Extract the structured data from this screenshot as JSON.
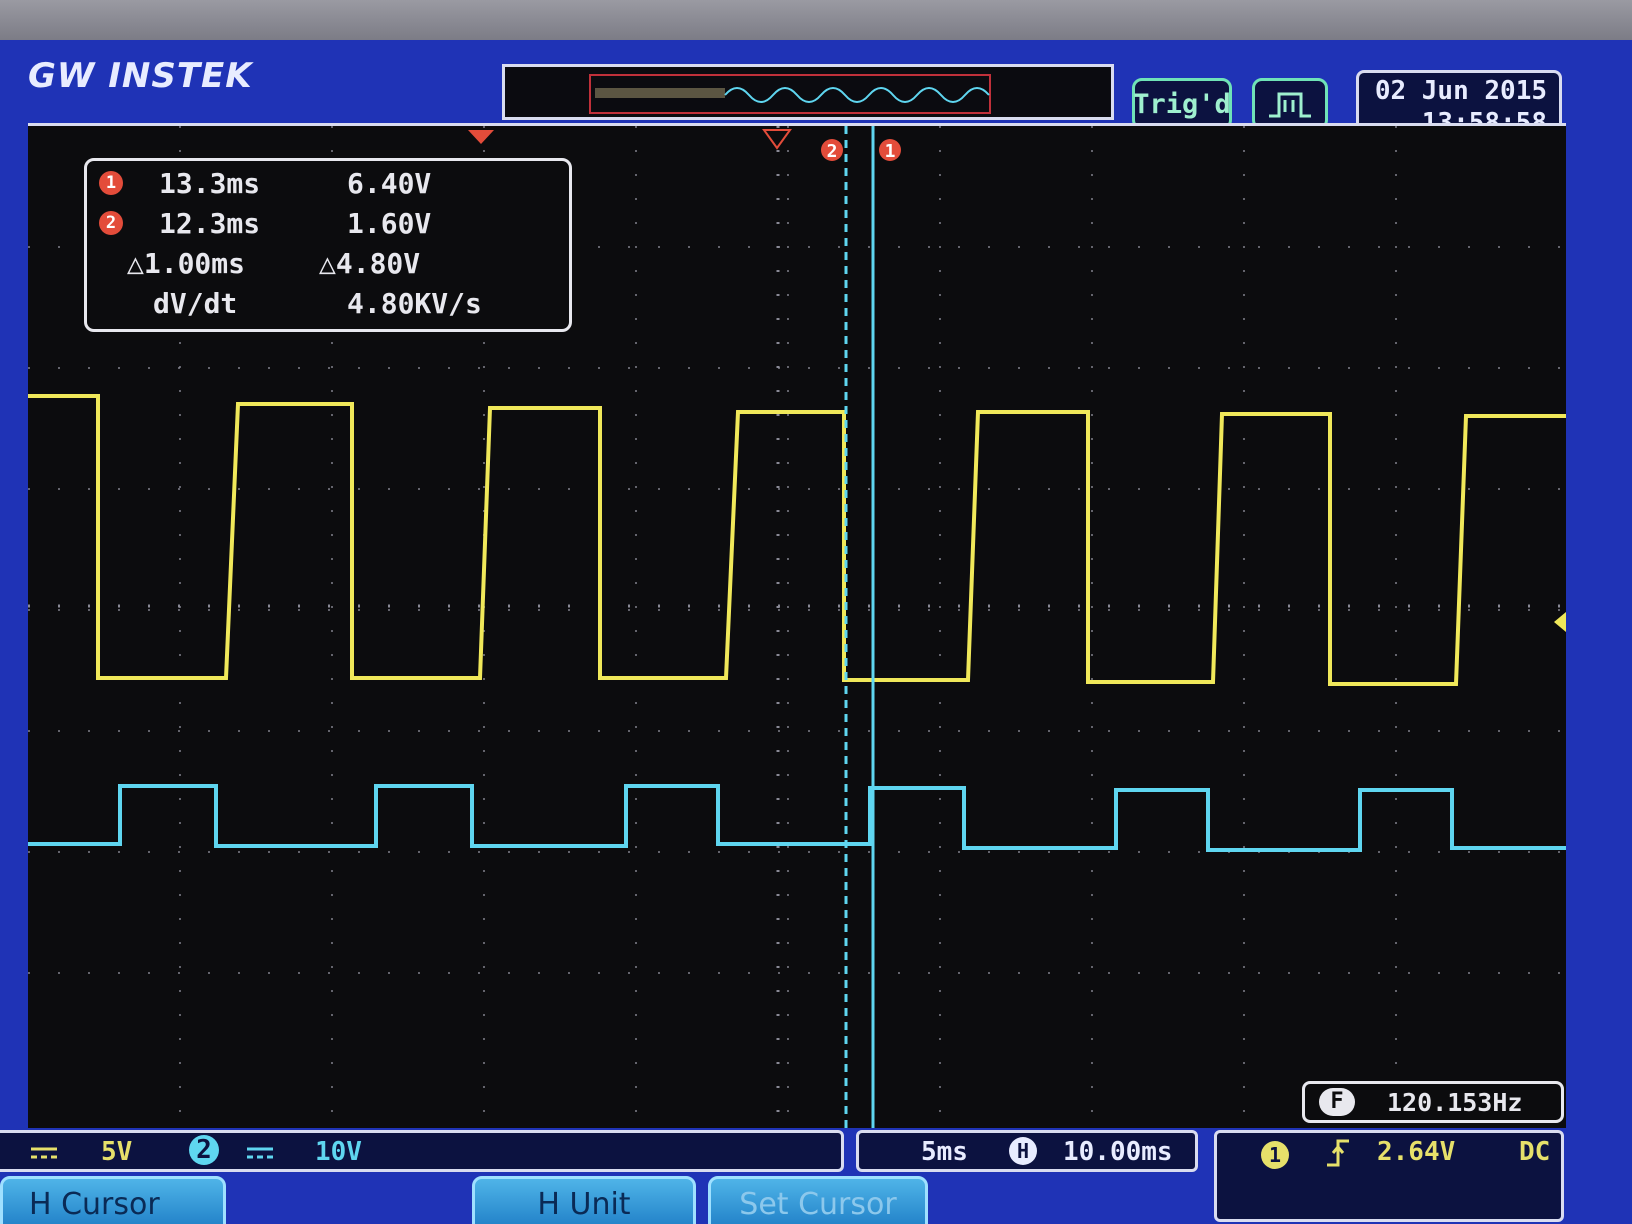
{
  "brand": "GW INSTEK",
  "status": {
    "trigger_state": "Trig'd"
  },
  "datetime": {
    "date": "02 Jun 2015",
    "time": "13:58:58"
  },
  "cursor_readout": {
    "rows": [
      {
        "marker": "1",
        "time": "13.3ms",
        "value": "6.40V"
      },
      {
        "marker": "2",
        "time": "12.3ms",
        "value": "1.60V"
      },
      {
        "marker": "",
        "time": "△1.00ms",
        "value": "△4.80V"
      },
      {
        "marker": "",
        "time": "dV/dt",
        "value": "4.80KV/s"
      }
    ]
  },
  "cursor_markers": {
    "cursor1": "1",
    "cursor2": "2"
  },
  "frequency": {
    "icon_label": "F",
    "value": "120.153Hz"
  },
  "channels": {
    "ch1_scale": "5V",
    "ch2_label": "2",
    "ch2_scale": "10V"
  },
  "timebase": {
    "scale": "5ms",
    "h_icon": "H",
    "position": "10.00ms"
  },
  "trigger": {
    "source": "1",
    "level": "2.64V",
    "coupling": "DC"
  },
  "softkeys": {
    "hcursor": "H Cursor",
    "hunit": "H Unit",
    "setcursor": "Set Cursor"
  },
  "colors": {
    "ch1": "#f0e85a",
    "ch2": "#5fd6f0",
    "cursor_marker": "#e34c3a",
    "grid": "#8a8a96",
    "screen_bezel": "#1f33b6"
  },
  "icons": {
    "dc_coupling": "dc-coupling-icon",
    "rising_edge": "rising-edge-icon",
    "trigger_mode": "pulse-icon"
  }
}
